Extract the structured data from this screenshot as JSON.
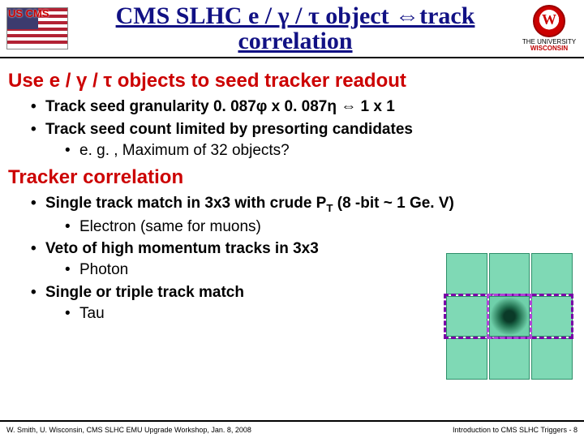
{
  "header": {
    "logo_left_label": "US CMS",
    "title": "CMS SLHC e / γ / τ object ⇔track correlation",
    "wisconsin_top": "THE UNIVERSITY",
    "wisconsin_bottom": "WISCONSIN"
  },
  "sections": {
    "seed_heading": "Use e / γ / τ objects to seed tracker readout",
    "seed_b1": "Track seed granularity 0. 087φ x 0. 087η ⇔ 1 x 1",
    "seed_b2": "Track seed count limited by presorting candidates",
    "seed_b2_sub": "e. g. , Maximum of 32 objects?",
    "corr_heading": "Tracker correlation",
    "corr_b1_pre": "Single track match in 3x3 with crude P",
    "corr_b1_sub": "T",
    "corr_b1_post": " (8 -bit ~ 1 Ge. V)",
    "corr_b1_s1": "Electron (same for muons)",
    "corr_b2": "Veto of high momentum tracks in 3x3",
    "corr_b2_s1": "Photon",
    "corr_b3": "Single or triple track match",
    "corr_b3_s1": "Tau"
  },
  "footer": {
    "left": "W. Smith, U. Wisconsin, CMS SLHC EMU Upgrade Workshop, Jan. 8, 2008",
    "right": "Introduction to CMS SLHC Triggers -  8"
  }
}
